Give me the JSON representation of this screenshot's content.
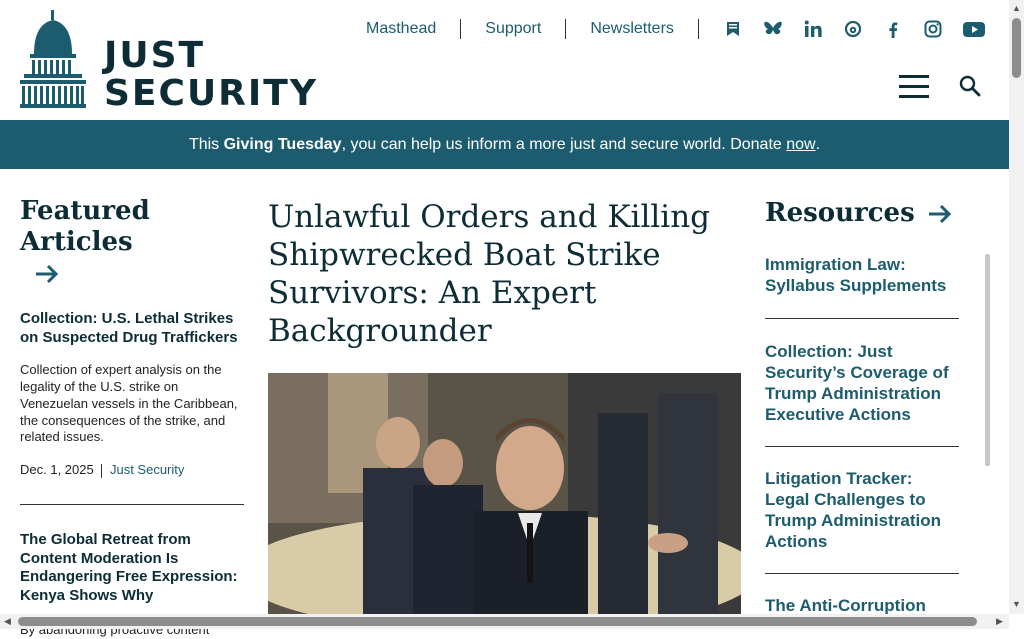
{
  "brand": {
    "name_line1": "JUST",
    "name_line2": "SECURITY"
  },
  "topnav": {
    "links": [
      "Masthead",
      "Support",
      "Newsletters"
    ],
    "social_icons": [
      "bookmark-newspaper-icon",
      "bluesky-icon",
      "linkedin-icon",
      "threads-icon",
      "facebook-icon",
      "instagram-icon",
      "youtube-icon"
    ]
  },
  "banner": {
    "prefix": "This ",
    "bold": "Giving Tuesday",
    "middle": ", you can help us inform a more just and secure world. Donate ",
    "link": "now",
    "suffix": "."
  },
  "featured": {
    "heading": "Featured Articles",
    "articles": [
      {
        "title": "Collection: U.S. Lethal Strikes on Suspected Drug Traffickers",
        "excerpt": "Collection of expert analysis on the legality of the U.S. strike on Venezuelan vessels in the Caribbean, the consequences of the strike, and related issues.",
        "date": "Dec. 1, 2025",
        "author": "Just Security"
      },
      {
        "title": "The Global Retreat from Content Moderation Is Endangering Free Expression: Kenya Shows Why",
        "excerpt": "By abandoning proactive content"
      }
    ]
  },
  "main": {
    "headline": "Unlawful Orders and Killing Shipwrecked Boat Strike Survivors: An Expert Backgrounder"
  },
  "resources": {
    "heading": "Resources",
    "items": [
      "Immigration Law: Syllabus Supplements",
      "Collection: Just Security’s Coverage of Trump Administration Executive Actions",
      "Litigation Tracker: Legal Challenges to Trump Administration Actions",
      "The Anti-Corruption Tracker: Mapping the"
    ]
  },
  "colors": {
    "brand_teal": "#1c5c6e",
    "dark_navy": "#0c2c36"
  }
}
